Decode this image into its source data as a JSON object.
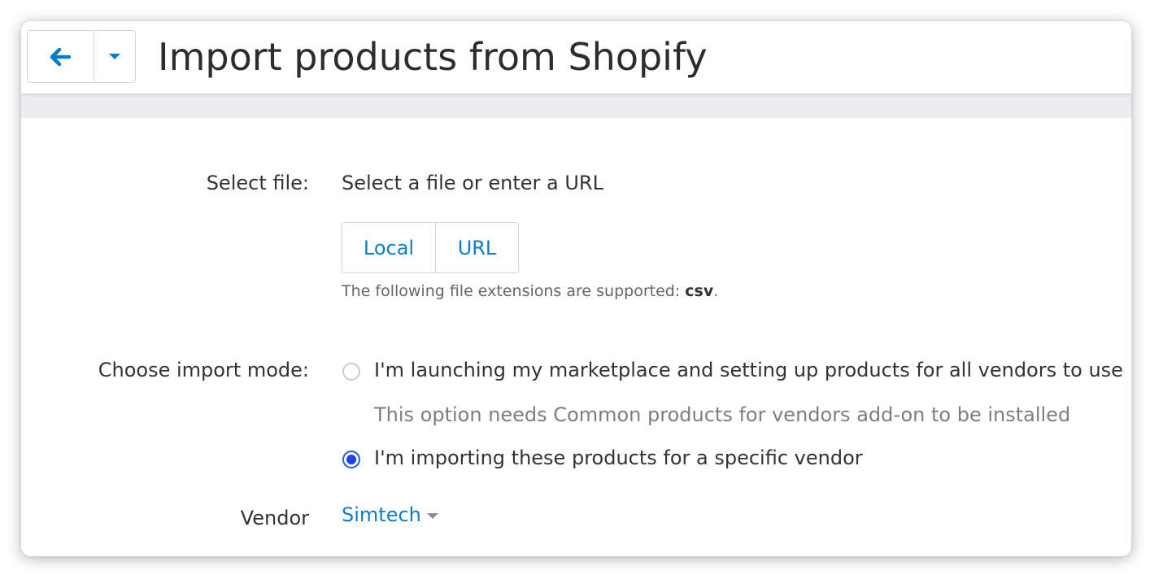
{
  "header": {
    "title": "Import products from Shopify",
    "back_icon": "arrow-left-icon",
    "dropdown_icon": "caret-down-icon",
    "accent_color": "#0b7dc4"
  },
  "form": {
    "select_file": {
      "label": "Select file:",
      "prompt": "Select a file or enter a URL",
      "options": [
        "Local",
        "URL"
      ],
      "help_prefix": "The following file extensions are supported: ",
      "help_ext": "csv",
      "help_suffix": "."
    },
    "import_mode": {
      "label": "Choose import mode:",
      "options": [
        {
          "label": "I'm launching my marketplace and setting up products for all vendors to use",
          "selected": false,
          "note": "This option needs Common products for vendors add-on to be installed"
        },
        {
          "label": "I'm importing these products for a specific vendor",
          "selected": true
        }
      ]
    },
    "vendor": {
      "label": "Vendor",
      "value": "Simtech"
    }
  }
}
